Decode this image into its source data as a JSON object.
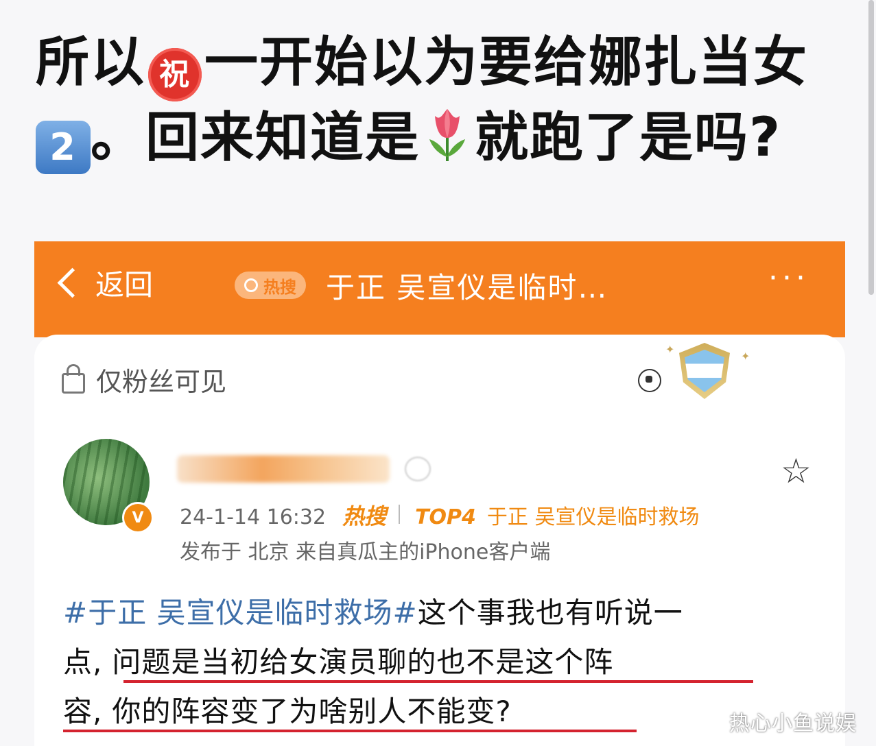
{
  "headline": {
    "line1_text": "所以",
    "emoji_zhu": "祝",
    "line1_rest": "一开始以为要给娜扎当女",
    "emoji_two": "2",
    "line2_text": "。回来知道是",
    "line2_rest": "就跑了是吗?"
  },
  "navbar": {
    "back_label": "返回",
    "tag_label": "热搜",
    "title": "于正 吴宣仪是临时…",
    "more": "···",
    "color": "#f57f1f"
  },
  "post": {
    "visibility": "仅粉丝可见",
    "verified_mark": "V",
    "date": "24-1-14 16:32",
    "hot_label": "热搜",
    "rank": "TOP4",
    "hot_title": "于正 吴宣仪是临时救场",
    "location": "发布于 北京 来自真瓜主的iPhone客户端",
    "topic": "#于正 吴宣仪是临时救场#",
    "body_1": "这个事我也有听说一",
    "body_2a": "点,",
    "body_2b": "问题是当初给女演员聊的也不是这个阵",
    "body_3a": "容,",
    "body_3b": "你的阵容变了为啥别人不能变?"
  },
  "watermark": "热心小鱼说娱",
  "icons": [
    "chevron-left-icon",
    "search-icon",
    "lock-icon",
    "star-icon",
    "soccer-ball-icon",
    "shield-badge-icon",
    "verified-icon",
    "tulip-icon"
  ]
}
